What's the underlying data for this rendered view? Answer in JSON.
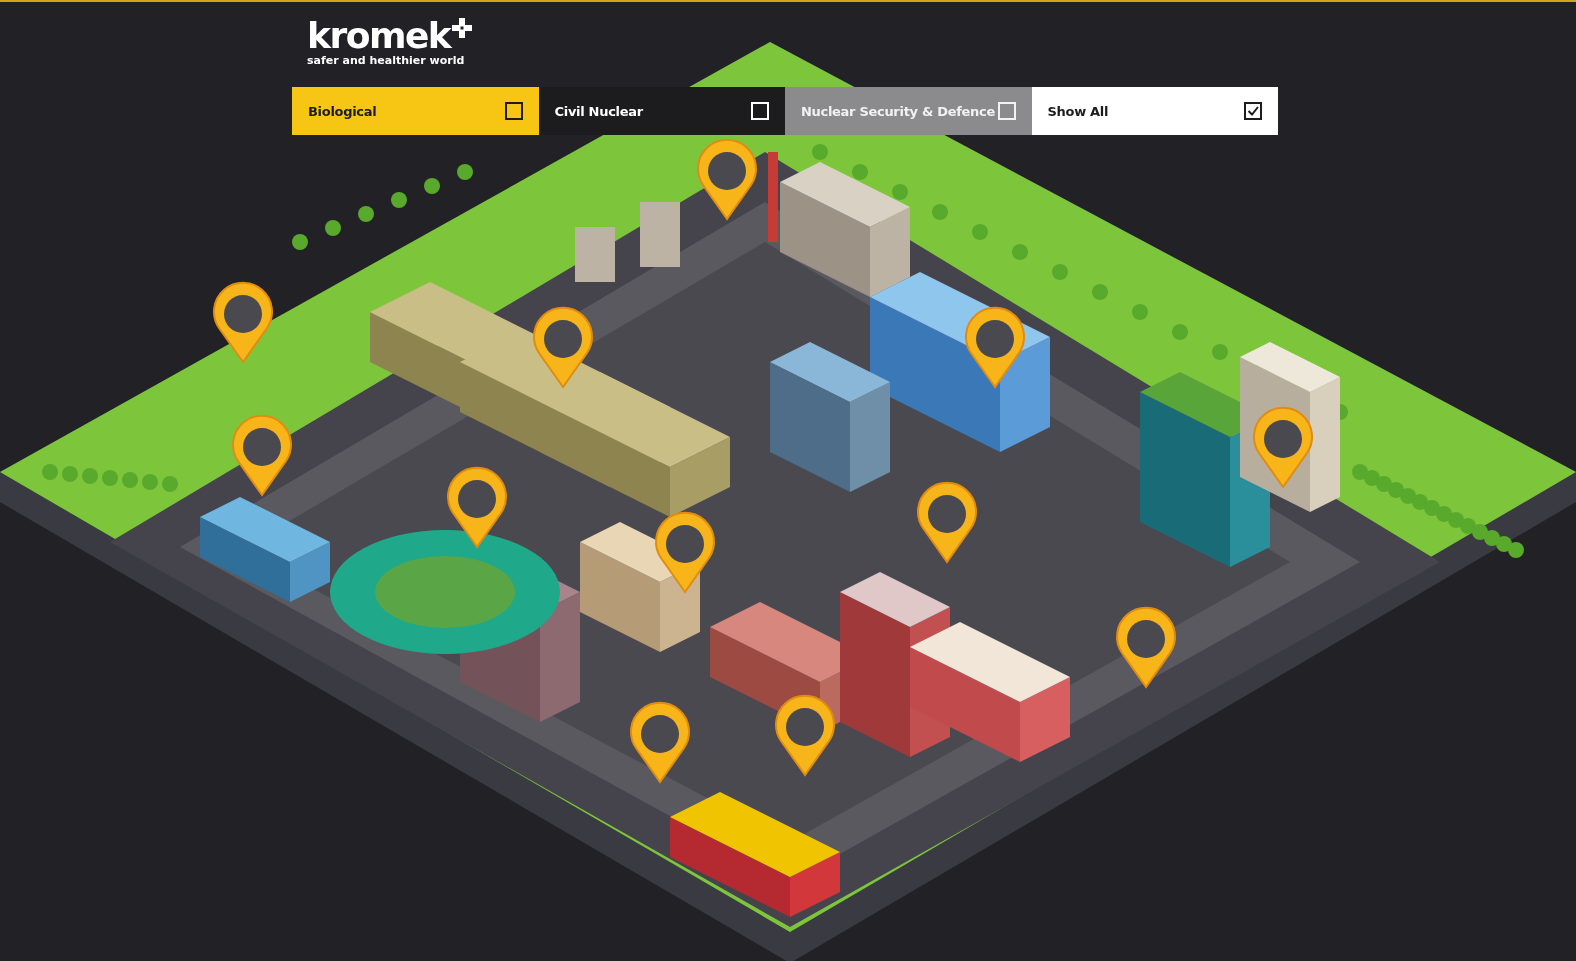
{
  "logo": {
    "wordmark": "kromek",
    "tagline": "safer and healthier world"
  },
  "filters": [
    {
      "label": "Biological",
      "kind": "biological",
      "checked": false
    },
    {
      "label": "Civil Nuclear",
      "kind": "civil",
      "checked": false
    },
    {
      "label": "Nuclear Security & Defence",
      "kind": "defence",
      "checked": false
    },
    {
      "label": "Show All",
      "kind": "all",
      "checked": true
    }
  ]
}
